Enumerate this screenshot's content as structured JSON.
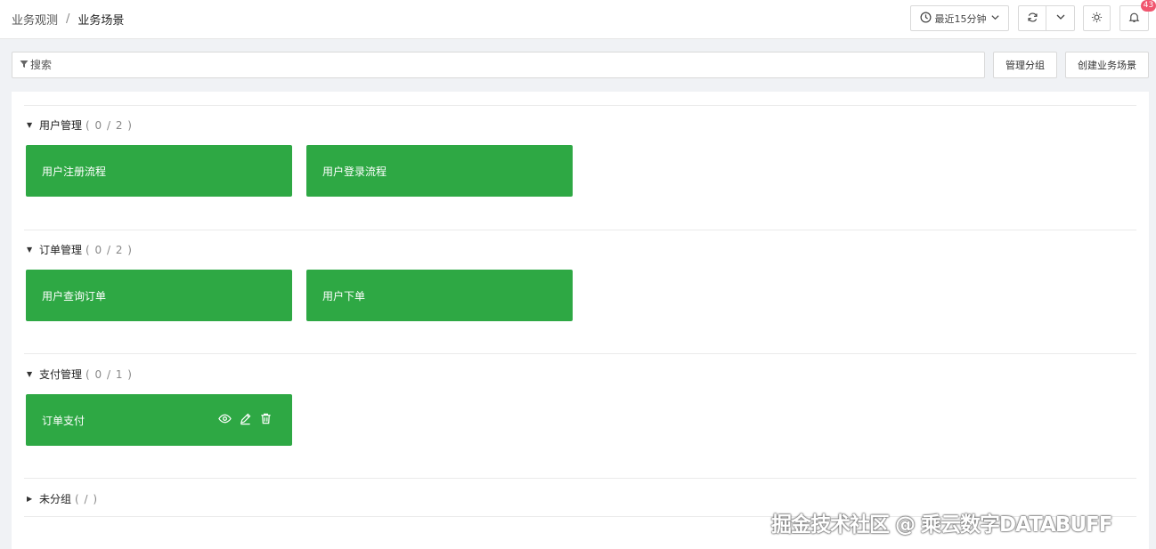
{
  "breadcrumb": {
    "parent": "业务观测",
    "separator": "/",
    "current": "业务场景"
  },
  "toolbar": {
    "time_range": "最近15分钟",
    "notification_count": "43"
  },
  "search": {
    "placeholder": "搜索",
    "value": ""
  },
  "actions": {
    "manage_groups": "管理分组",
    "create_scene": "创建业务场景"
  },
  "groups": [
    {
      "name": "用户管理",
      "count": "( 0 / 2 )",
      "expanded": true,
      "cards": [
        {
          "label": "用户注册流程"
        },
        {
          "label": "用户登录流程"
        }
      ]
    },
    {
      "name": "订单管理",
      "count": "( 0 / 2 )",
      "expanded": true,
      "cards": [
        {
          "label": "用户查询订单"
        },
        {
          "label": "用户下单"
        }
      ]
    },
    {
      "name": "支付管理",
      "count": "( 0 / 1 )",
      "expanded": true,
      "cards": [
        {
          "label": "订单支付"
        }
      ]
    },
    {
      "name": "未分组",
      "count": "( / )",
      "expanded": false,
      "cards": []
    }
  ],
  "card_icons": [
    "eye-icon",
    "edit-icon",
    "trash-icon"
  ],
  "colors": {
    "card_green": "#2ea844",
    "badge_red": "#f0556e"
  },
  "watermark": "掘金技术社区 @ 乘云数字DATABUFF"
}
